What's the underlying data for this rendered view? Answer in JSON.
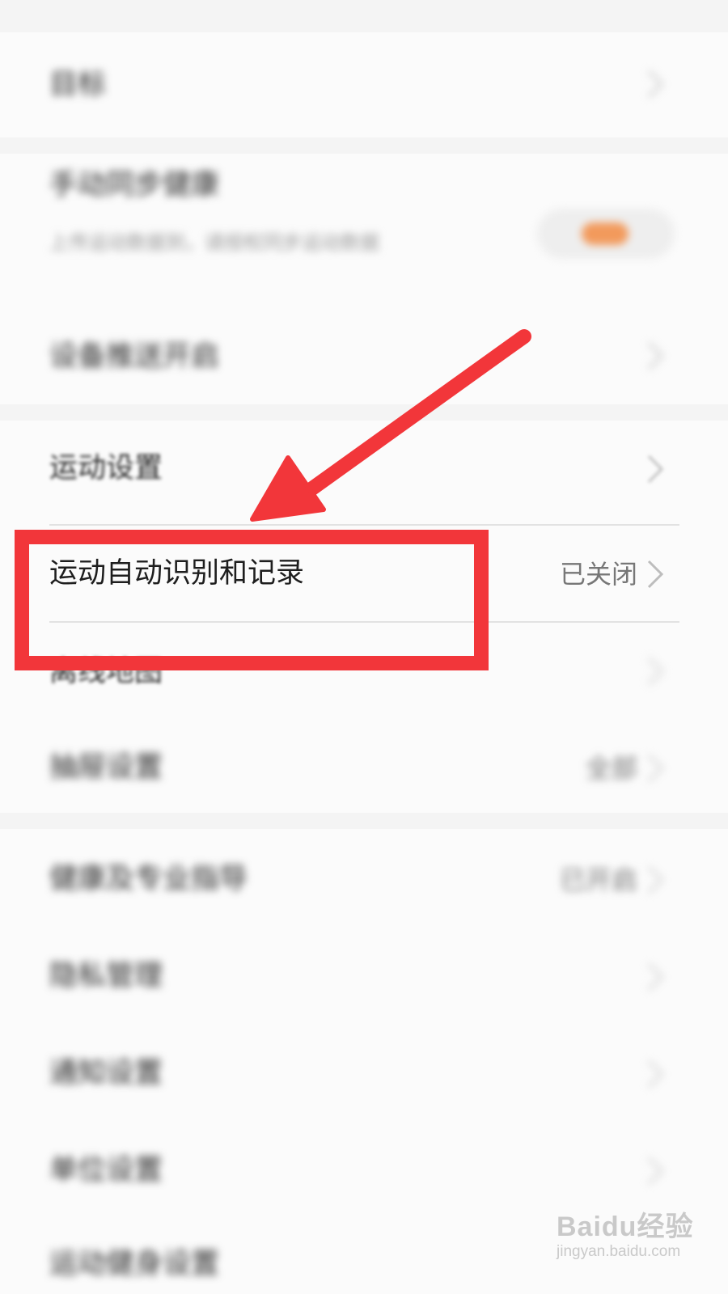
{
  "settings": {
    "items": [
      {
        "label": "目标",
        "value": ""
      },
      {
        "label": "手动同步健康",
        "sublabel": "上传运动数据到，请授权同步运动数据",
        "toggle": true
      },
      {
        "label": "设备推送开启",
        "value": ""
      },
      {
        "label": "运动设置",
        "value": ""
      },
      {
        "label": "运动自动识别和记录",
        "value": "已关闭"
      },
      {
        "label": "离线地图",
        "value": ""
      },
      {
        "label": "抽屉设置",
        "value": "全部"
      },
      {
        "label": "健康及专业指导",
        "value": "已开启"
      },
      {
        "label": "隐私管理",
        "value": ""
      },
      {
        "label": "通知设置",
        "value": ""
      },
      {
        "label": "单位设置",
        "value": ""
      },
      {
        "label": "运动健身设置",
        "value": ""
      }
    ]
  },
  "annotation": {
    "color": "#f2363a"
  },
  "watermark": {
    "brand": "Baidu经验",
    "url": "jingyan.baidu.com"
  }
}
